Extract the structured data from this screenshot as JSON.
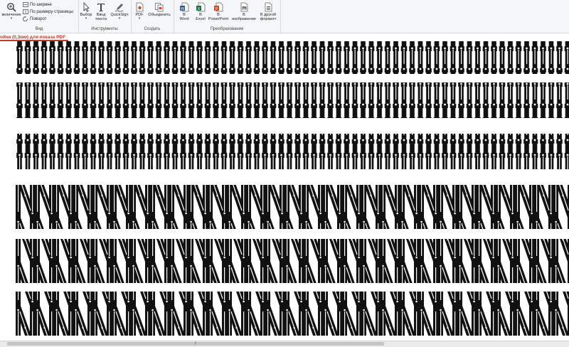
{
  "ribbon": {
    "view": {
      "zoom_label": "величение",
      "fit_width": "По ширине",
      "fit_page": "По размеру страницы",
      "rotate": "Поворот",
      "group_label": "Вид"
    },
    "tools": {
      "select_label": "Выбор",
      "text_label_1": "Ввод",
      "text_label_2": "текста",
      "quicksign_label": "QuickSign",
      "group_label": "Инструменты"
    },
    "create": {
      "pdf_label": "PDF",
      "merge_label": "Объединить",
      "group_label": "Создать"
    },
    "convert": {
      "word_1": "В",
      "word_2": "Word",
      "excel_1": "В",
      "excel_2": "Excel",
      "ppt_1": "В",
      "ppt_2": "PowerPoint",
      "image_1": "В",
      "image_2": "изображение",
      "other_1": "В другой",
      "other_2": "формат",
      "group_label": "Преобразование"
    },
    "colors": {
      "word": "#2b579a",
      "excel": "#217346",
      "ppt": "#d24726",
      "image": "#555555",
      "accent": "#c0392b"
    }
  },
  "document_tab": {
    "title": "ойки (0,3мм) для показа PDF"
  },
  "scrollbar": {
    "grip": "⦀"
  }
}
